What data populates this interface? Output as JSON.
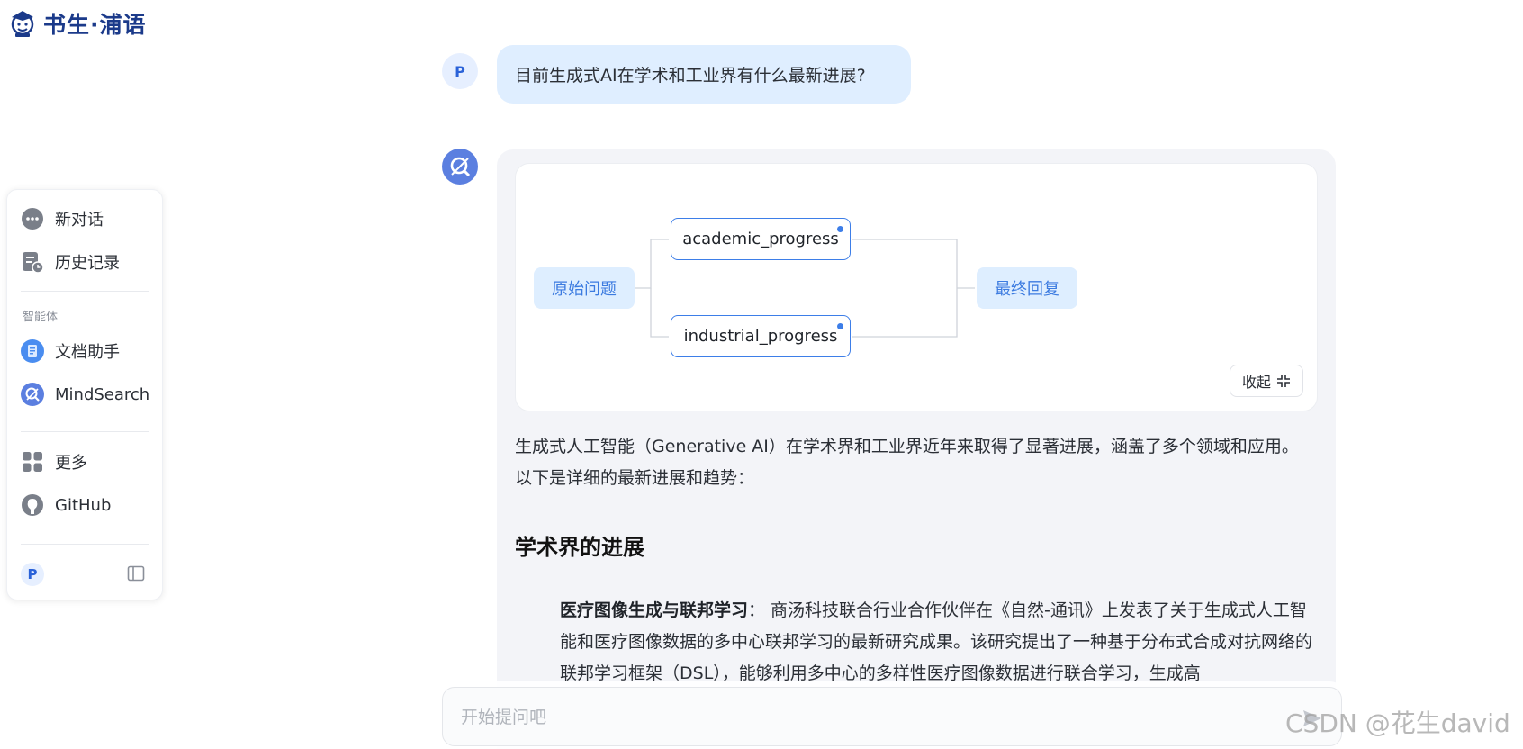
{
  "brand": {
    "name": "书生·浦语"
  },
  "sidebar": {
    "items": [
      {
        "label": "新对话",
        "icon": "chat-bubble-icon"
      },
      {
        "label": "历史记录",
        "icon": "history-icon"
      }
    ],
    "section_label": "智能体",
    "agents": [
      {
        "label": "文档助手",
        "icon": "doc-assistant-icon"
      },
      {
        "label": "MindSearch",
        "icon": "mindsearch-icon"
      }
    ],
    "more": [
      {
        "label": "更多",
        "icon": "grid-icon"
      },
      {
        "label": "GitHub",
        "icon": "github-icon"
      }
    ],
    "user_initial": "P"
  },
  "chat": {
    "user_initial": "P",
    "question": "目前生成式AI在学术和工业界有什么最新进展?",
    "graph": {
      "start_label": "原始问题",
      "nodes": [
        "academic_progress",
        "industrial_progress"
      ],
      "end_label": "最终回复",
      "collapse_label": "收起"
    },
    "answer_intro": "生成式人工智能（Generative AI）在学术界和工业界近年来取得了显著进展，涵盖了多个领域和应用。以下是详细的最新进展和趋势：",
    "section_title": "学术界的进展",
    "item_title": "医疗图像生成与联邦学习",
    "item_body": "： 商汤科技联合行业合作伙伴在《自然-通讯》上发表了关于生成式人工智能和医疗图像数据的多中心联邦学习的最新研究成果。该研究提出了一种基于分布式合成对抗网络的联邦学习框架（DSL），能够利用多中心的多样性医疗图像数据进行联合学习，生成高"
  },
  "input": {
    "placeholder": "开始提问吧"
  },
  "watermark": "CSDN @花生david",
  "colors": {
    "accent": "#3d7ee8",
    "tag_bg": "#deeeff",
    "panel_bg": "#f3f4f8",
    "brand": "#1b3a8a"
  }
}
